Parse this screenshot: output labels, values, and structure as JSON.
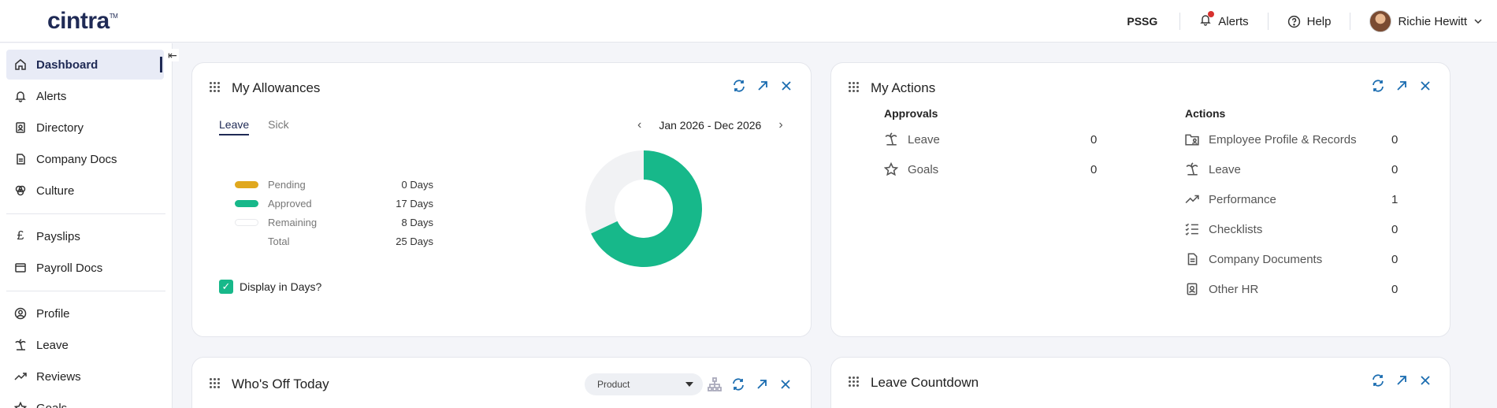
{
  "header": {
    "logo": "cintra",
    "logo_tm": "TM",
    "org": "PSSG",
    "alerts_label": "Alerts",
    "help_label": "Help",
    "user_name": "Richie Hewitt"
  },
  "sidebar": {
    "items": [
      {
        "label": "Dashboard",
        "icon": "home-icon"
      },
      {
        "label": "Alerts",
        "icon": "bell-icon"
      },
      {
        "label": "Directory",
        "icon": "contacts-icon"
      },
      {
        "label": "Company Docs",
        "icon": "docs-icon"
      },
      {
        "label": "Culture",
        "icon": "culture-icon"
      },
      {
        "label": "Payslips",
        "icon": "pound-icon"
      },
      {
        "label": "Payroll Docs",
        "icon": "folder-icon"
      },
      {
        "label": "Profile",
        "icon": "profile-icon"
      },
      {
        "label": "Leave",
        "icon": "palm-icon"
      },
      {
        "label": "Reviews",
        "icon": "trend-icon"
      },
      {
        "label": "Goals",
        "icon": "star-icon"
      }
    ]
  },
  "allowances": {
    "title": "My Allowances",
    "tabs": [
      "Leave",
      "Sick"
    ],
    "period": "Jan 2026 - Dec 2026",
    "legend": [
      {
        "label": "Pending",
        "value": "0 Days",
        "color": "#e0a81e"
      },
      {
        "label": "Approved",
        "value": "17 Days",
        "color": "#17b88a"
      },
      {
        "label": "Remaining",
        "value": "8 Days",
        "color": "#f1f2f4"
      },
      {
        "label": "Total",
        "value": "25 Days",
        "color": ""
      }
    ],
    "display_in_days": "Display in Days?",
    "donut": {
      "approved": 17,
      "remaining": 8,
      "pending": 0
    }
  },
  "actions": {
    "title": "My Actions",
    "approvals_head": "Approvals",
    "actions_head": "Actions",
    "approvals": [
      {
        "label": "Leave",
        "count": "0",
        "icon": "palm-icon"
      },
      {
        "label": "Goals",
        "count": "0",
        "icon": "star-icon"
      }
    ],
    "items": [
      {
        "label": "Employee Profile & Records",
        "count": "0",
        "icon": "folder-person-icon"
      },
      {
        "label": "Leave",
        "count": "0",
        "icon": "palm-icon"
      },
      {
        "label": "Performance",
        "count": "1",
        "icon": "trend-icon"
      },
      {
        "label": "Checklists",
        "count": "0",
        "icon": "checklist-icon"
      },
      {
        "label": "Company Documents",
        "count": "0",
        "icon": "docs-icon"
      },
      {
        "label": "Other HR",
        "count": "0",
        "icon": "contacts-icon"
      }
    ]
  },
  "whos_off": {
    "title": "Who's Off Today",
    "department": "Product"
  },
  "countdown": {
    "title": "Leave Countdown"
  }
}
